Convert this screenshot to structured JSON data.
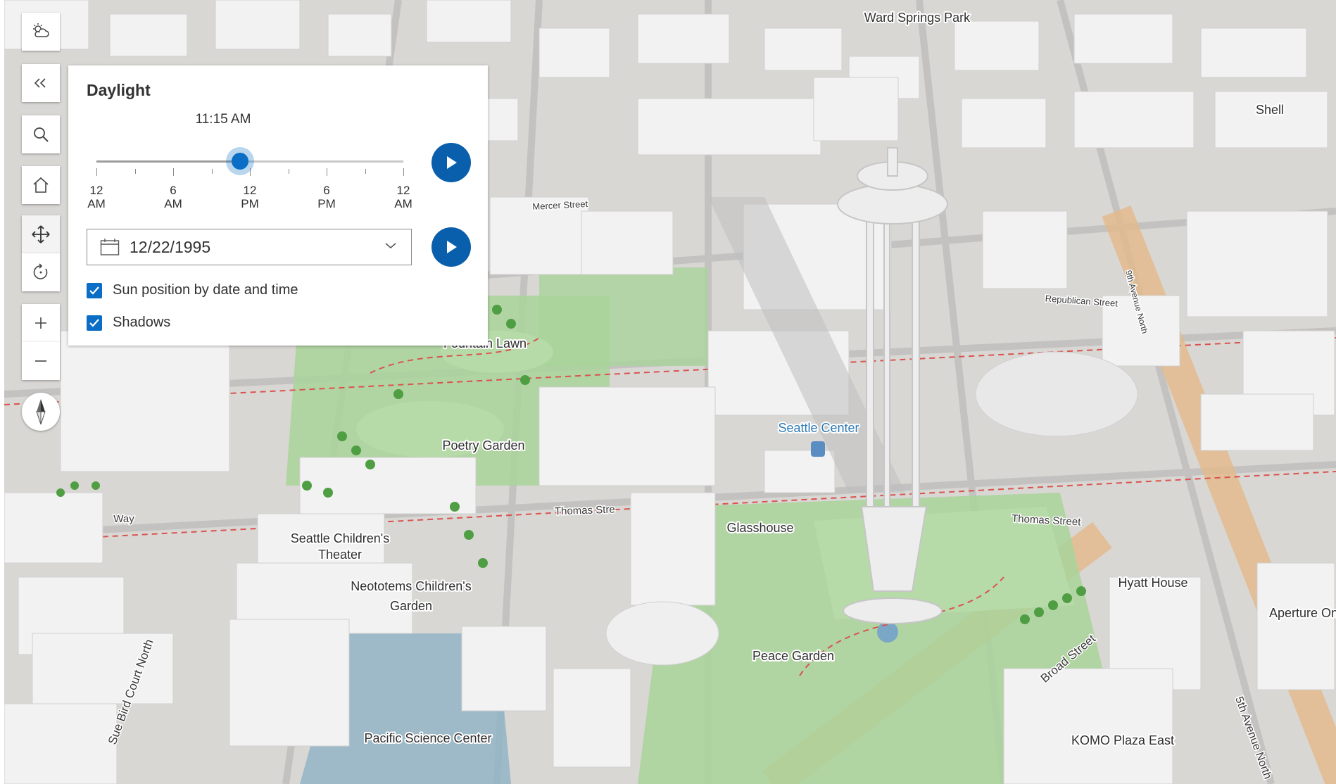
{
  "daylight_panel": {
    "title": "Daylight",
    "time_value": "11:15 AM",
    "time_fraction_of_day": 0.469,
    "tick_labels": [
      {
        "top": "12",
        "bottom": "AM"
      },
      {
        "top": "6",
        "bottom": "AM"
      },
      {
        "top": "12",
        "bottom": "PM"
      },
      {
        "top": "6",
        "bottom": "PM"
      },
      {
        "top": "12",
        "bottom": "AM"
      }
    ],
    "date_value": "12/22/1995",
    "options": [
      {
        "label": "Sun position by date and time",
        "checked": true
      },
      {
        "label": "Shadows",
        "checked": true
      }
    ]
  },
  "toolbar": {
    "tools": [
      "weather-icon",
      "collapse-icon",
      "search-icon",
      "home-icon",
      "pan-icon",
      "rotate-icon",
      "zoom-in-icon",
      "zoom-out-icon",
      "compass-icon"
    ]
  },
  "map": {
    "places": [
      "Ward Springs Park",
      "Shell",
      "Seattle Center",
      "Fountain Lawn",
      "Poetry Garden",
      "Seattle Children's",
      "Theater",
      "Neototems Children's",
      "Garden",
      "Glasshouse",
      "Hyatt House",
      "Aperture On",
      "Peace Garden",
      "Pacific Science Center",
      "KOMO Plaza East"
    ],
    "streets": [
      "Thomas Stre",
      "Thomas Street",
      "Republican Street",
      "Mercer Street",
      "Sue Bird Court North",
      "5th Avenue North",
      "9th Avenue North",
      "Broad Street",
      "Way"
    ]
  },
  "colors": {
    "accent": "#0a6ec6",
    "play_button": "#0a5fad",
    "ground": "#d9d7d4",
    "park": "#a9d39a",
    "building": "#f2f2f2"
  }
}
